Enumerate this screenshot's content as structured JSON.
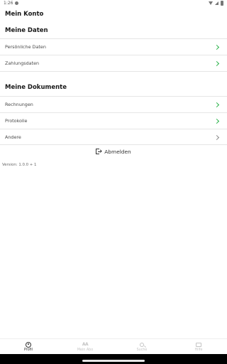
{
  "status_bar": {
    "time": "1:26",
    "icons": [
      "notification-dot-icon",
      "wifi-icon",
      "signal-icon",
      "battery-icon"
    ]
  },
  "page": {
    "title": "Mein Konto"
  },
  "sections": [
    {
      "heading": "Meine Daten",
      "items": [
        {
          "label": "Persönliche Daten",
          "chevron_color": "#2bb34a"
        },
        {
          "label": "Zahlungsdaten",
          "chevron_color": "#2bb34a"
        }
      ]
    },
    {
      "heading": "Meine Dokumente",
      "items": [
        {
          "label": "Rechnungen",
          "chevron_color": "#2bb34a"
        },
        {
          "label": "Protokolle",
          "chevron_color": "#2bb34a"
        },
        {
          "label": "Andere",
          "chevron_color": "#8a8a8a"
        }
      ]
    }
  ],
  "logout": {
    "label": "Abmelden",
    "icon": "logout-icon"
  },
  "version": "Version: 1.0.0 + 1",
  "bottom_nav": {
    "items": [
      {
        "label": "Profil",
        "icon": "profile-icon",
        "active": true
      },
      {
        "label": "Mein Abo",
        "icon": "ad-icon",
        "icon_text": "AA",
        "active": false
      },
      {
        "label": "Suche",
        "icon": "search-icon",
        "active": false
      },
      {
        "label": "Hilfe",
        "icon": "chat-icon",
        "active": false
      }
    ]
  },
  "colors": {
    "accent": "#2bb34a",
    "text": "#1a1a1a",
    "muted": "#c4c4c4"
  }
}
